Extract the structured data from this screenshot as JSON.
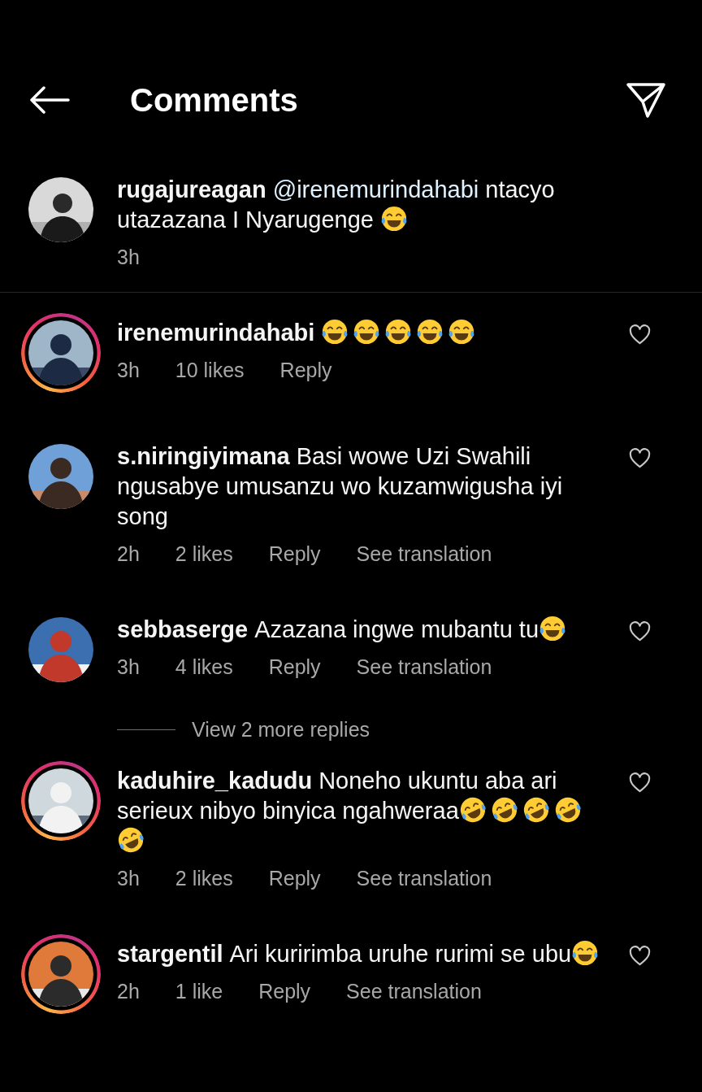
{
  "header": {
    "title": "Comments"
  },
  "caption": {
    "user": "rugajureagan",
    "mention": "@irenemurindahabi",
    "text": "ntacyo utazazana I Nyarugenge",
    "emojis": [
      {
        "kind": "tears_of_joy"
      }
    ],
    "time": "3h",
    "has_story": false
  },
  "comments": [
    {
      "user": "irenemurindahabi",
      "emojis": [
        {
          "kind": "tears_of_joy"
        },
        {
          "kind": "tears_of_joy"
        },
        {
          "kind": "tears_of_joy"
        },
        {
          "kind": "tears_of_joy"
        },
        {
          "kind": "tears_of_joy"
        }
      ],
      "time": "3h",
      "likes": "10 likes",
      "reply": "Reply",
      "has_story": true
    },
    {
      "user": "s.niringiyimana",
      "text": "Basi wowe Uzi Swahili ngusabye umusanzu wo kuzamwigusha iyi song",
      "time": "2h",
      "likes": "2 likes",
      "reply": "Reply",
      "translation": "See translation",
      "has_story": false
    },
    {
      "user": "sebbaserge",
      "text": "Azazana ingwe mubantu tu",
      "emojis": [
        {
          "kind": "tears_of_joy"
        }
      ],
      "time": "3h",
      "likes": "4 likes",
      "reply": "Reply",
      "translation": "See translation",
      "has_story": false,
      "view_more": "View 2 more replies"
    },
    {
      "user": "kaduhire_kadudu",
      "text": "Noneho ukuntu aba ari serieux nibyo binyica ngahweraa",
      "emojis": [
        {
          "kind": "rolling_laughing"
        },
        {
          "kind": "rolling_laughing"
        },
        {
          "kind": "rolling_laughing"
        },
        {
          "kind": "rolling_laughing"
        },
        {
          "kind": "rolling_laughing"
        }
      ],
      "time": "3h",
      "likes": "2 likes",
      "reply": "Reply",
      "translation": "See translation",
      "has_story": true
    },
    {
      "user": "stargentil",
      "text": "Ari kuririmba uruhe rurimi se ubu",
      "emojis": [
        {
          "kind": "tears_of_joy"
        }
      ],
      "time": "2h",
      "likes": "1 like",
      "reply": "Reply",
      "translation": "See translation",
      "has_story": true
    }
  ]
}
